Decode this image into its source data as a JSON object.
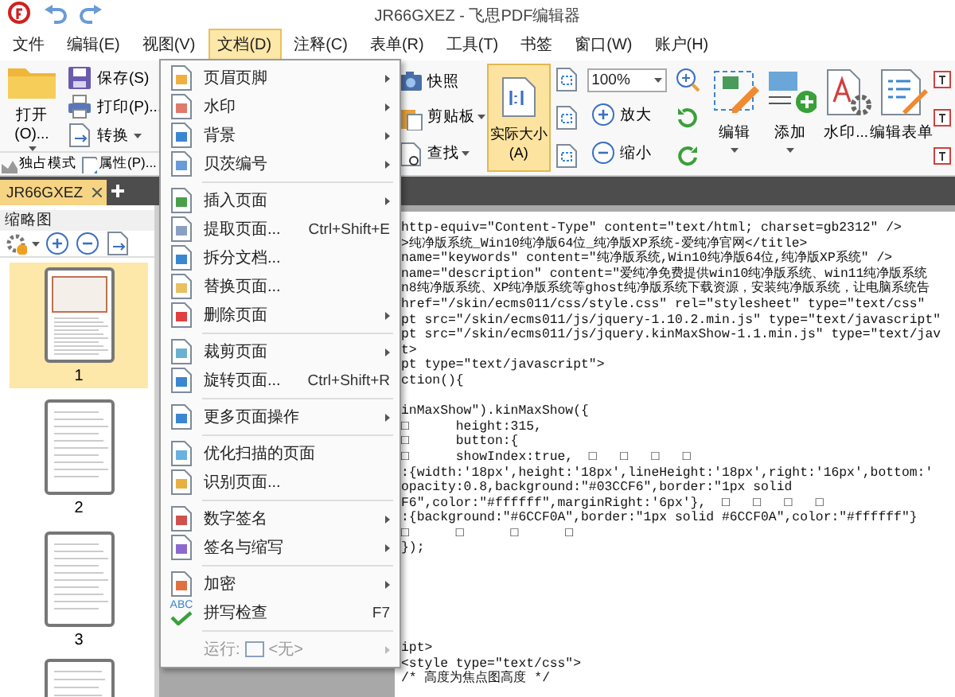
{
  "window": {
    "title": "JR66GXEZ - 飞思PDF编辑器"
  },
  "menu_bar": [
    {
      "label": "文件",
      "selected": false
    },
    {
      "label": "编辑(E)",
      "selected": false
    },
    {
      "label": "视图(V)",
      "selected": false
    },
    {
      "label": "文档(D)",
      "selected": true
    },
    {
      "label": "注释(C)",
      "selected": false
    },
    {
      "label": "表单(R)",
      "selected": false
    },
    {
      "label": "工具(T)",
      "selected": false
    },
    {
      "label": "书签",
      "selected": false
    },
    {
      "label": "窗口(W)",
      "selected": false
    },
    {
      "label": "账户(H)",
      "selected": false
    }
  ],
  "ribbon": {
    "open": {
      "label": "打开(O)..."
    },
    "file_buttons": [
      {
        "label": "保存(S)",
        "dropdown": false
      },
      {
        "label": "打印(P)...",
        "dropdown": false
      },
      {
        "label": "转换",
        "dropdown": true
      }
    ],
    "row3_buttons": [
      {
        "label": "独占模式"
      },
      {
        "label": "属性(P)..."
      }
    ],
    "view_buttons": [
      {
        "label": "快照",
        "dropdown": false
      },
      {
        "label": "剪贴板",
        "dropdown": true
      },
      {
        "label": "查找",
        "dropdown": true
      }
    ],
    "actual_size": {
      "label": "实际大小(A)",
      "selected": true
    },
    "zoom_field": {
      "value": "100%"
    },
    "zoom_buttons": [
      {
        "label": "放大"
      },
      {
        "label": "缩小"
      }
    ],
    "large_buttons": [
      {
        "label": "编辑",
        "dropdown": true
      },
      {
        "label": "添加",
        "dropdown": true
      },
      {
        "label": "水印...",
        "dropdown": false
      },
      {
        "label": "编辑表单",
        "dropdown": false
      }
    ]
  },
  "tabs": [
    {
      "label": "JR66GXEZ",
      "selected": true
    }
  ],
  "thumbnail_panel": {
    "title": "缩略图",
    "pages": [
      {
        "label": "1",
        "selected": true
      },
      {
        "label": "2",
        "selected": false
      },
      {
        "label": "3",
        "selected": false
      }
    ]
  },
  "document_menu": {
    "sections": [
      [
        {
          "label": "页眉页脚",
          "submenu": true,
          "disabled": false
        },
        {
          "label": "水印",
          "submenu": true,
          "disabled": false
        },
        {
          "label": "背景",
          "submenu": true,
          "disabled": false
        },
        {
          "label": "贝茨编号",
          "submenu": true,
          "disabled": false
        }
      ],
      [
        {
          "label": "插入页面",
          "submenu": true,
          "disabled": false
        },
        {
          "label": "提取页面...",
          "shortcut": "Ctrl+Shift+E",
          "submenu": false,
          "disabled": false
        },
        {
          "label": "拆分文档...",
          "submenu": false,
          "disabled": false
        },
        {
          "label": "替换页面...",
          "submenu": false,
          "disabled": false
        },
        {
          "label": "删除页面",
          "submenu": true,
          "disabled": false
        }
      ],
      [
        {
          "label": "裁剪页面",
          "submenu": true,
          "disabled": false
        },
        {
          "label": "旋转页面...",
          "shortcut": "Ctrl+Shift+R",
          "submenu": false,
          "disabled": false
        }
      ],
      [
        {
          "label": "更多页面操作",
          "submenu": true,
          "disabled": false
        }
      ],
      [
        {
          "label": "优化扫描的页面",
          "submenu": false,
          "disabled": false
        },
        {
          "label": "识别页面...",
          "submenu": false,
          "disabled": false
        }
      ],
      [
        {
          "label": "数字签名",
          "submenu": true,
          "disabled": false
        },
        {
          "label": "签名与缩写",
          "submenu": true,
          "disabled": false
        }
      ],
      [
        {
          "label": "加密",
          "submenu": true,
          "disabled": false
        },
        {
          "label": "拼写检查",
          "icon_text": "ABC",
          "shortcut": "F7",
          "submenu": false,
          "disabled": false
        }
      ],
      [
        {
          "label": "运行:",
          "value": "<无>",
          "submenu": true,
          "disabled": true
        }
      ]
    ]
  },
  "code_blocks": [
    [
      "http-equiv=\"Content-Type\" content=\"text/html; charset=gb2312\" />",
      ">纯净版系统_Win10纯净版64位_纯净版XP系统-爱纯净官网</title>",
      "name=\"keywords\" content=\"纯净版系统,Win10纯净版64位,纯净版XP系统\" />",
      "name=\"description\" content=\"爱纯净免费提供win10纯净版系统、win11纯净版系统",
      "n8纯净版系统、XP纯净版系统等ghost纯净版系统下载资源，安装纯净版系统，让电脑系统告",
      "href=\"/skin/ecms011/css/style.css\" rel=\"stylesheet\" type=\"text/css\"",
      "pt src=\"/skin/ecms011/js/jquery-1.10.2.min.js\" type=\"text/javascript\"",
      "pt src=\"/skin/ecms011/js/jquery.kinMaxShow-1.1.min.js\" type=\"text/jav",
      "t>",
      "pt type=\"text/javascript\">",
      "ction(){"
    ],
    [
      "inMaxShow\").kinMaxShow({",
      "□      height:315,",
      "□      button:{",
      "□      showIndex:true,  □   □   □   □",
      ":{width:'18px',height:'18px',lineHeight:'18px',right:'16px',bottom:'",
      "opacity:0.8,background:\"#03CCF6\",border:\"1px solid",
      "F6\",color:\"#ffffff\",marginRight:'6px'},  □   □   □   □",
      ":{background:\"#6CCF0A\",border:\"1px solid #6CCF0A\",color:\"#ffffff\"}",
      "□      □      □      □",
      "});"
    ],
    [
      "ipt>",
      "<style type=\"text/css\">",
      "/* 高度为焦点图高度 */"
    ]
  ]
}
